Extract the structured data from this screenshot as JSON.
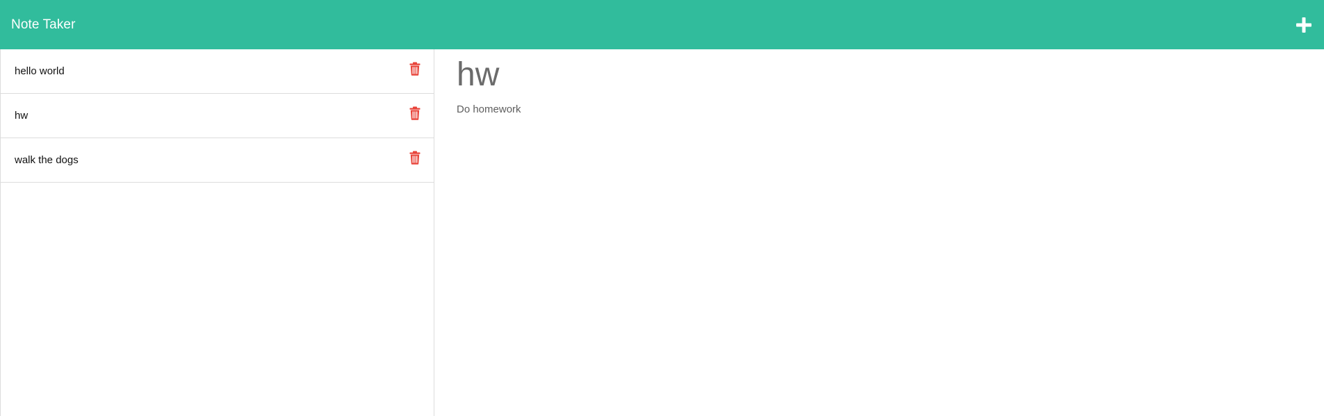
{
  "navbar": {
    "brand": "Note Taker",
    "new_note_icon": "plus-icon",
    "color": "#31bc9c"
  },
  "notes": [
    {
      "title": "hello world",
      "delete_icon": "trash-icon"
    },
    {
      "title": "hw",
      "delete_icon": "trash-icon"
    },
    {
      "title": "walk the dogs",
      "delete_icon": "trash-icon"
    }
  ],
  "active_note": {
    "title": "hw",
    "text": "Do homework"
  },
  "colors": {
    "accent": "#31bc9c",
    "delete": "#e8443a"
  }
}
